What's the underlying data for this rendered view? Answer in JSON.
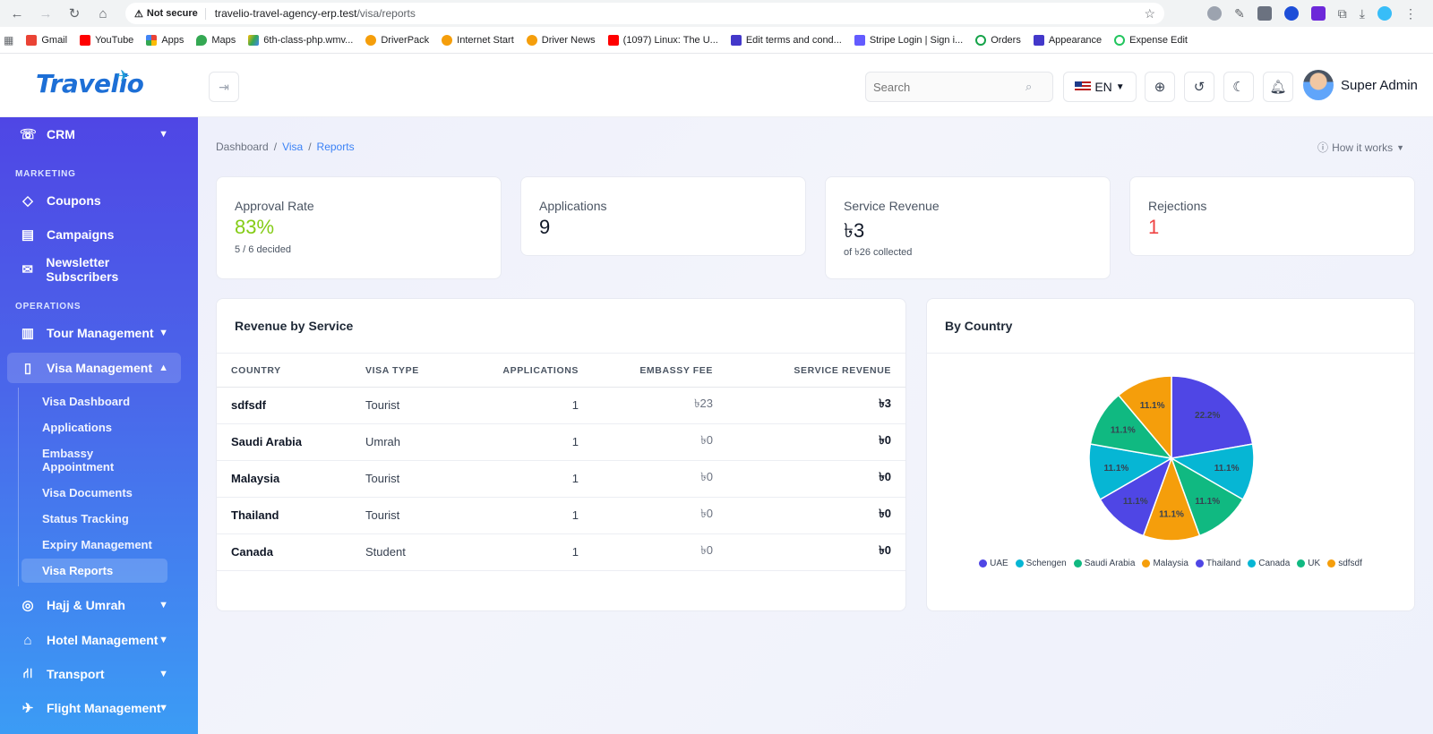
{
  "browser": {
    "not_secure": "Not secure",
    "url_host": "travelio-travel-agency-erp.test",
    "url_path": "/visa/reports",
    "bookmarks": [
      "Gmail",
      "YouTube",
      "Apps",
      "Maps",
      "6th-class-php.wmv...",
      "DriverPack",
      "Internet Start",
      "Driver News",
      "(1097) Linux: The U...",
      "Edit terms and cond...",
      "Stripe Login | Sign i...",
      "Orders",
      "Appearance",
      "Expense Edit"
    ]
  },
  "header": {
    "logo": "Travelio",
    "search_placeholder": "Search",
    "language": "EN",
    "user_name": "Super Admin"
  },
  "sidebar": {
    "crm": "CRM",
    "section_marketing": "MARKETING",
    "coupons": "Coupons",
    "campaigns": "Campaigns",
    "newsletter": "Newsletter Subscribers",
    "section_operations": "OPERATIONS",
    "tour_management": "Tour Management",
    "visa_management": "Visa Management",
    "visa_sub": [
      "Visa Dashboard",
      "Applications",
      "Embassy Appointment",
      "Visa Documents",
      "Status Tracking",
      "Expiry Management",
      "Visa Reports"
    ],
    "hajj": "Hajj & Umrah",
    "hotel": "Hotel Management",
    "transport": "Transport",
    "flight": "Flight Management"
  },
  "breadcrumb": {
    "dashboard": "Dashboard",
    "visa": "Visa",
    "reports": "Reports"
  },
  "how_it_works": "How it works",
  "stats": {
    "approval_label": "Approval Rate",
    "approval_value": "83%",
    "approval_sub": "5 / 6 decided",
    "applications_label": "Applications",
    "applications_value": "9",
    "revenue_label": "Service Revenue",
    "revenue_value": "৳3",
    "revenue_sub": "of ৳26 collected",
    "rejections_label": "Rejections",
    "rejections_value": "1"
  },
  "colors": {
    "approval": "#84cc16",
    "rejections": "#ef4444",
    "accent": "#3b82f6"
  },
  "revenue_table": {
    "title": "Revenue by Service",
    "columns": [
      "COUNTRY",
      "VISA TYPE",
      "APPLICATIONS",
      "EMBASSY FEE",
      "SERVICE REVENUE"
    ],
    "rows": [
      [
        "sdfsdf",
        "Tourist",
        "1",
        "৳23",
        "৳3"
      ],
      [
        "Saudi Arabia",
        "Umrah",
        "1",
        "৳0",
        "৳0"
      ],
      [
        "Malaysia",
        "Tourist",
        "1",
        "৳0",
        "৳0"
      ],
      [
        "Thailand",
        "Tourist",
        "1",
        "৳0",
        "৳0"
      ],
      [
        "Canada",
        "Student",
        "1",
        "৳0",
        "৳0"
      ]
    ]
  },
  "by_country_title": "By Country",
  "chart_data": {
    "type": "pie",
    "categories": [
      "UAE",
      "Schengen",
      "Saudi Arabia",
      "Malaysia",
      "Thailand",
      "Canada",
      "UK",
      "sdfsdf"
    ],
    "values": [
      22.2,
      11.1,
      11.1,
      11.1,
      11.1,
      11.1,
      11.1,
      11.1
    ],
    "labels": [
      "22.2%",
      "11.1%",
      "11.1%",
      "11.1%",
      "11.1%",
      "11.1%",
      "11.1%",
      "11.1%"
    ],
    "colors": [
      "#4f46e5",
      "#06b6d4",
      "#10b981",
      "#f59e0b",
      "#4f46e5",
      "#06b6d4",
      "#10b981",
      "#f59e0b"
    ],
    "legend_position": "bottom"
  }
}
